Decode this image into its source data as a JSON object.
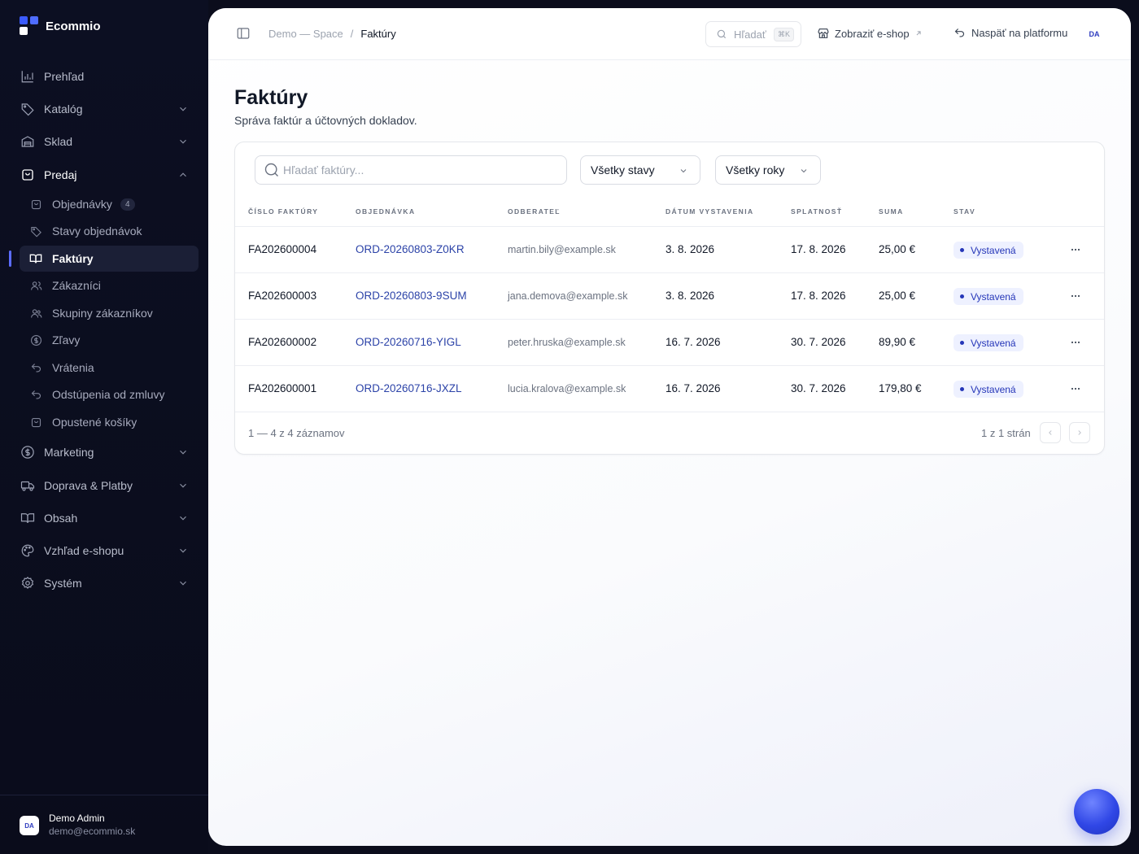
{
  "brand": {
    "name": "Ecommio"
  },
  "nav": {
    "items": [
      {
        "label": "Prehľad",
        "icon": "bar-chart-icon"
      },
      {
        "label": "Katalóg",
        "icon": "tag-icon"
      },
      {
        "label": "Sklad",
        "icon": "warehouse-icon"
      },
      {
        "label": "Predaj",
        "icon": "shopping-bag-icon"
      },
      {
        "label": "Marketing",
        "icon": "dollar-circle-icon"
      },
      {
        "label": "Doprava & Platby",
        "icon": "truck-icon"
      },
      {
        "label": "Obsah",
        "icon": "book-open-icon"
      },
      {
        "label": "Vzhľad e-shopu",
        "icon": "palette-icon"
      },
      {
        "label": "Systém",
        "icon": "settings-icon"
      }
    ],
    "sales_sub": [
      {
        "label": "Objednávky",
        "badge": "4"
      },
      {
        "label": "Stavy objednávok"
      },
      {
        "label": "Faktúry"
      },
      {
        "label": "Zákazníci"
      },
      {
        "label": "Skupiny zákazníkov"
      },
      {
        "label": "Zľavy"
      },
      {
        "label": "Vrátenia"
      },
      {
        "label": "Odstúpenia od zmluvy"
      },
      {
        "label": "Opustené košíky"
      }
    ]
  },
  "user": {
    "initials": "DA",
    "name": "Demo Admin",
    "email": "demo@ecommio.sk"
  },
  "topbar": {
    "crumb_space": "Demo — Space",
    "crumb_sep": "/",
    "crumb_current": "Faktúry",
    "search_label": "Hľadať",
    "search_kbd": "⌘K",
    "shop_label": "Zobraziť e-shop",
    "back_label": "Naspäť na platformu",
    "avatar": "DA"
  },
  "page": {
    "title": "Faktúry",
    "subtitle": "Správa faktúr a účtovných dokladov."
  },
  "filters": {
    "search_placeholder": "Hľadať faktúry...",
    "status": "Všetky stavy",
    "year": "Všetky roky"
  },
  "table": {
    "headers": [
      "Číslo faktúry",
      "Objednávka",
      "Odberateľ",
      "Dátum vystavenia",
      "Splatnosť",
      "Suma",
      "Stav"
    ],
    "rows": [
      {
        "number": "FA202600004",
        "order": "ORD-20260803-Z0KR",
        "customer": "martin.bily@example.sk",
        "issued": "3. 8. 2026",
        "due": "17. 8. 2026",
        "amount": "25,00 €",
        "status": "Vystavená"
      },
      {
        "number": "FA202600003",
        "order": "ORD-20260803-9SUM",
        "customer": "jana.demova@example.sk",
        "issued": "3. 8. 2026",
        "due": "17. 8. 2026",
        "amount": "25,00 €",
        "status": "Vystavená"
      },
      {
        "number": "FA202600002",
        "order": "ORD-20260716-YIGL",
        "customer": "peter.hruska@example.sk",
        "issued": "16. 7. 2026",
        "due": "30. 7. 2026",
        "amount": "89,90 €",
        "status": "Vystavená"
      },
      {
        "number": "FA202600001",
        "order": "ORD-20260716-JXZL",
        "customer": "lucia.kralova@example.sk",
        "issued": "16. 7. 2026",
        "due": "30. 7. 2026",
        "amount": "179,80 €",
        "status": "Vystavená"
      }
    ]
  },
  "pagination": {
    "count": "1 — 4 z 4 záznamov",
    "pages": "1 z 1 strán"
  },
  "colors": {
    "accent": "#2c43a8",
    "sidebar": "#0c0f22",
    "status_pill": "#eef1ff"
  }
}
